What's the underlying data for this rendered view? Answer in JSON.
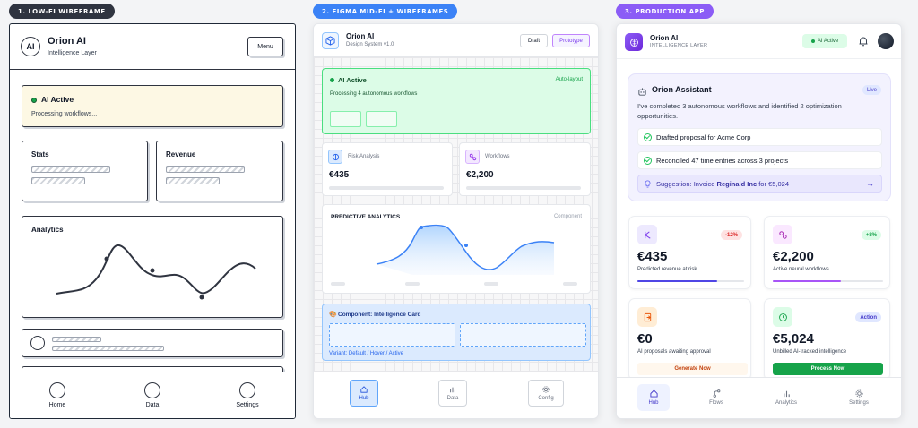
{
  "labels": {
    "wireframe": "1. LOW-FI WIREFRAME",
    "figma": "2. FIGMA MID-FI + WIREFRAMES",
    "production": "3. PRODUCTION APP"
  },
  "colors": {
    "wireframe_pill": "#2f3440",
    "figma_pill": "#3b82f6",
    "production_pill": "#8b5cf6",
    "accent": "#7c3aed",
    "green": "#16a34a"
  },
  "wireframe": {
    "logo": "AI",
    "title": "Orion AI",
    "subtitle": "Intelligence Layer",
    "menu": "Menu",
    "status_title": "AI Active",
    "status_text": "Processing workflows...",
    "card_stats": "Stats",
    "card_revenue": "Revenue",
    "card_analytics": "Analytics",
    "nav": [
      "Home",
      "Data",
      "Settings"
    ]
  },
  "figma": {
    "title": "Orion AI",
    "subtitle": "Design System v1.0",
    "btn_draft": "Draft",
    "btn_prototype": "Prototype",
    "status_title": "AI Active",
    "status_text": "Processing 4 autonomous workflows",
    "status_tag": "Auto-layout",
    "kpi1_label": "Risk Analysis",
    "kpi1_value": "€435",
    "kpi2_label": "Workflows",
    "kpi2_value": "€2,200",
    "chart_title": "PREDICTIVE ANALYTICS",
    "chart_tag": "Component",
    "component_title": "Component: Intelligence Card",
    "component_variant": "Variant: Default / Hover / Active",
    "nav": [
      "Hub",
      "Data",
      "Config"
    ]
  },
  "production": {
    "title": "Orion AI",
    "subtitle": "INTELLIGENCE LAYER",
    "status_chip": "AI Active",
    "assistant_title": "Orion Assistant",
    "assistant_badge": "Live",
    "assistant_message": "I've completed 3 autonomous workflows and identified 2 optimization opportunities.",
    "tasks": [
      "Drafted proposal for Acme Corp",
      "Reconciled 47 time entries across 3 projects"
    ],
    "suggestion_prefix": "Suggestion: Invoice ",
    "suggestion_client": "Reginald Inc",
    "suggestion_suffix": " for €5,024",
    "cards": [
      {
        "value": "€435",
        "label": "Predicted revenue at risk",
        "badge": "-12%",
        "progress": 0.75
      },
      {
        "value": "€2,200",
        "label": "Active neural workflows",
        "badge": "+8%",
        "progress": 0.62
      },
      {
        "value": "€0",
        "label": "AI proposals awaiting approval",
        "button": "Generate Now"
      },
      {
        "value": "€5,024",
        "label": "Unbilled AI-tracked intelligence",
        "badge": "Action",
        "button": "Process Now"
      }
    ],
    "nav": [
      "Hub",
      "Flows",
      "Analytics",
      "Settings"
    ]
  }
}
